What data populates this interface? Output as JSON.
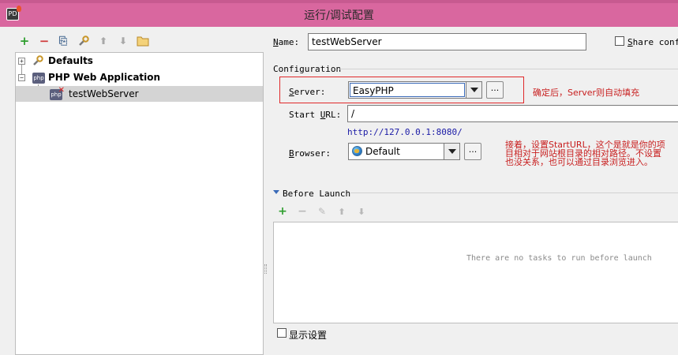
{
  "window": {
    "title": "运行/调试配置",
    "icon_text": "PD"
  },
  "colors": {
    "titlebar": "#d9679f",
    "annotation": "#c81e1e",
    "highlight": "#e0292b",
    "link": "#1a1aa6",
    "selection": "#d4d4d4"
  },
  "toolbar": {
    "add": "+",
    "remove": "−",
    "copy": "⎘",
    "edit": "✎",
    "up": "⬆",
    "down": "⬇",
    "folder": "▭",
    "icons": [
      "plus-icon",
      "minus-icon",
      "copy-icon",
      "wrench-icon",
      "arrow-up-icon",
      "arrow-down-icon",
      "folder-icon"
    ]
  },
  "tree": {
    "items": [
      {
        "label": "Defaults",
        "expander": "+"
      },
      {
        "label": "PHP Web Application",
        "expander": "−"
      },
      {
        "label": "testWebServer"
      }
    ],
    "php_icon_text": "php",
    "x_mark": "✕"
  },
  "form": {
    "name_label_u": "N",
    "name_label_rest": "ame:",
    "name_value": "testWebServer",
    "share_label_u": "S",
    "share_label_rest": "hare confi",
    "configuration_label": "Configuration",
    "server_label_u": "S",
    "server_label_rest": "erver:",
    "server_value": "EasyPHP",
    "browse_button": "...",
    "start_url_label_pre": "Start ",
    "start_url_label_u": "U",
    "start_url_label_rest": "RL:",
    "start_url_value": "/",
    "url_hint": "http://127.0.0.1:8080/",
    "browser_label_u": "B",
    "browser_label_rest": "rowser:",
    "browser_value": "Default",
    "before_launch_label": "Before Launch",
    "tasks_empty": "There are no tasks to run before launch",
    "show_settings_label": "显示设置"
  },
  "task_toolbar": {
    "add": "+",
    "remove": "−",
    "edit": "✎",
    "up": "⬆",
    "down": "⬇"
  },
  "annotations": {
    "server_note": "确定后，Server则自动填充",
    "url_note_lines": [
      "接着，设置StartURL，这个是就是你的项",
      "目相对于网站根目录的相对路径。不设置",
      "也没关系，也可以通过目录浏览进入。"
    ]
  }
}
